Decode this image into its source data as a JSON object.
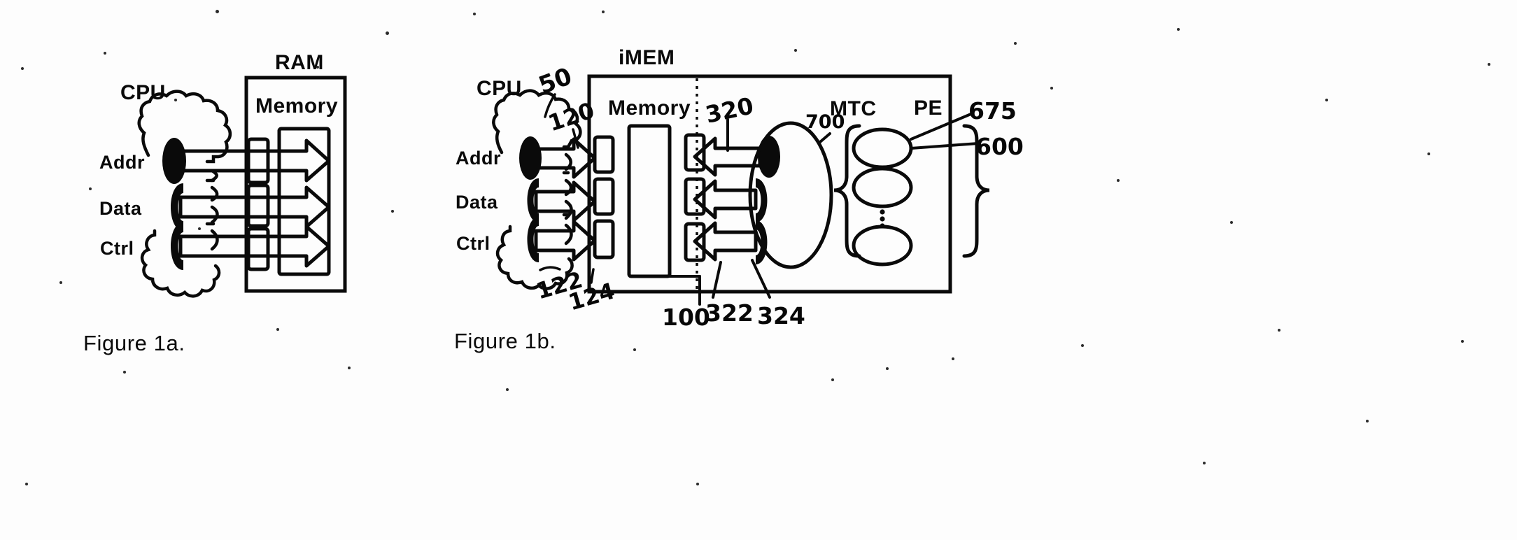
{
  "figure": {
    "kind": "patent-drawing",
    "ink_color": "#0a0a0a",
    "background_color": "#fdfdfd"
  },
  "fig_a": {
    "caption": "Figure 1a.",
    "cpu": {
      "title": "CPU",
      "buses": [
        "Addr",
        "Data",
        "Ctrl"
      ]
    },
    "ram": {
      "title": "RAM",
      "memory_label": "Memory",
      "port_count": 3
    }
  },
  "fig_b": {
    "caption": "Figure 1b.",
    "cpu": {
      "title": "CPU",
      "buses": [
        "Addr",
        "Data",
        "Ctrl"
      ]
    },
    "imem": {
      "title": "iMEM",
      "memory_label": "Memory",
      "mtc_label": "MTC",
      "pe_label": "PE",
      "left_port_count": 3,
      "right_port_count": 3,
      "pe_element_count": 3
    },
    "callouts": [
      {
        "id": "ref-50",
        "text": "50",
        "target": "cpu-cloud"
      },
      {
        "id": "ref-120",
        "text": "120",
        "target": "addr-bus"
      },
      {
        "id": "ref-122",
        "text": "122",
        "target": "data-bus"
      },
      {
        "id": "ref-124",
        "text": "124",
        "target": "ctrl-bus"
      },
      {
        "id": "ref-100",
        "text": "100",
        "target": "memory-block"
      },
      {
        "id": "ref-320",
        "text": "320",
        "target": "mtc-addr-bus"
      },
      {
        "id": "ref-322",
        "text": "322",
        "target": "mtc-data-bus"
      },
      {
        "id": "ref-324",
        "text": "324",
        "target": "mtc-ctrl-bus"
      },
      {
        "id": "ref-700",
        "text": "700",
        "target": "mtc-oval"
      },
      {
        "id": "ref-675",
        "text": "675",
        "target": "pe-array-top"
      },
      {
        "id": "ref-600",
        "text": "600",
        "target": "pe-element"
      }
    ]
  }
}
